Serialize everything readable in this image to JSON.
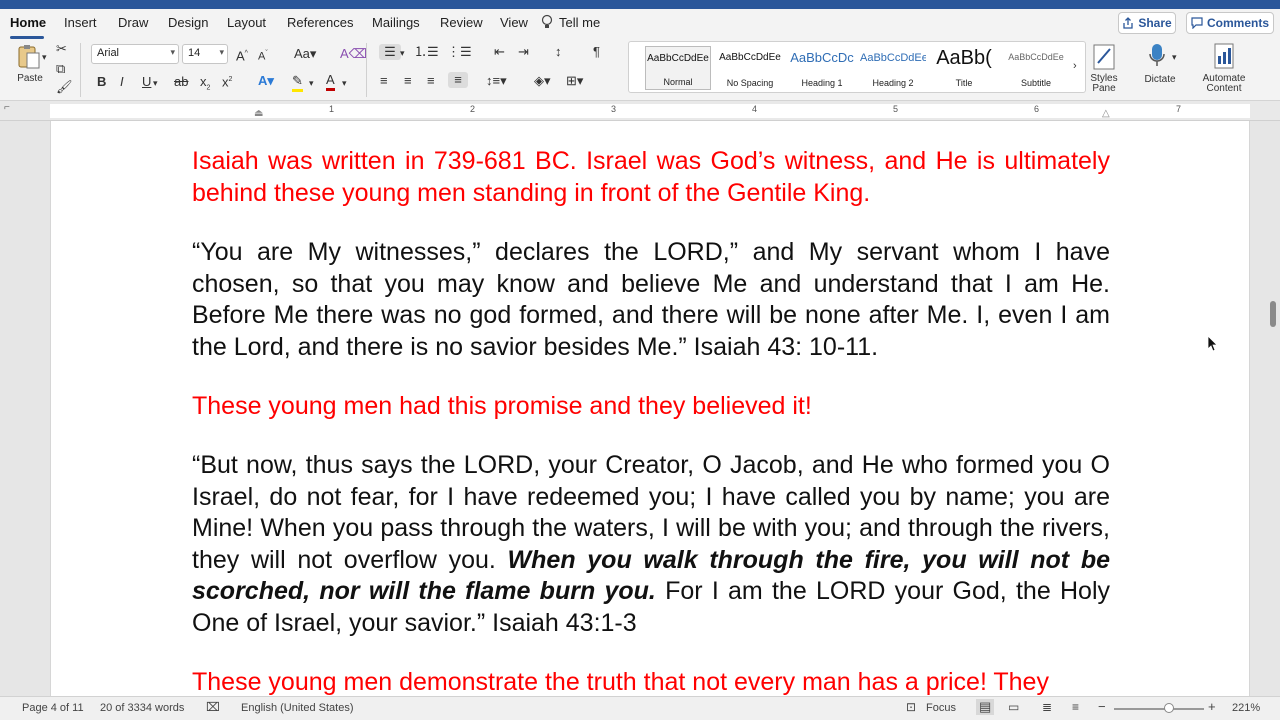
{
  "ribbon_tabs": [
    "Home",
    "Insert",
    "Draw",
    "Design",
    "Layout",
    "References",
    "Mailings",
    "Review",
    "View"
  ],
  "tell_me": "Tell me",
  "share_label": "Share",
  "comments_label": "Comments",
  "clipboard": {
    "paste_label": "Paste"
  },
  "font": {
    "name": "Arial",
    "size": "14"
  },
  "styles": [
    {
      "sample": "AaBbCcDdEe",
      "name": "Normal"
    },
    {
      "sample": "AaBbCcDdEe",
      "name": "No Spacing"
    },
    {
      "sample": "AaBbCcDc",
      "name": "Heading 1"
    },
    {
      "sample": "AaBbCcDdEe",
      "name": "Heading 2"
    },
    {
      "sample": "AaBb(",
      "name": "Title"
    },
    {
      "sample": "AaBbCcDdEe",
      "name": "Subtitle"
    }
  ],
  "tools": {
    "styles_pane": [
      "Styles",
      "Pane"
    ],
    "dictate": "Dictate",
    "automate": [
      "Automate",
      "Content"
    ]
  },
  "ruler_numbers": [
    "1",
    "2",
    "3",
    "4",
    "5",
    "6",
    "7"
  ],
  "document": {
    "p1": "Isaiah was written in 739-681 BC. Israel was God’s witness, and He is ultimately behind these young men standing in front of the Gentile King.",
    "p2": "“You are My witnesses,” declares the LORD,” and My servant whom I have chosen, so that you may know and believe Me and understand that I am He. Before Me there was no god formed, and there will be none after Me. I, even I am the Lord, and there is no savior besides Me.” Isaiah 43: 10-11.",
    "p3": "These young men had this promise and they believed it!",
    "p4_a": "“But now, thus says the LORD, your Creator, O Jacob, and He who formed you O Israel, do not fear, for I have redeemed you; I have called you by name; you are Mine! When you pass through the waters, I will be with you; and through the rivers, they will not overflow you. ",
    "p4_b": "When you walk through the fire, you will not be scorched, nor will the flame burn you.",
    "p4_c": " For I am the LORD your God, the Holy One of Israel, your savior.” Isaiah 43:1-3",
    "p5": "These young men demonstrate the truth that not every man has a price! They"
  },
  "status": {
    "page": "Page 4 of 11",
    "words": "20 of 3334 words",
    "language": "English (United States)",
    "focus": "Focus",
    "zoom": "221%"
  },
  "colors": {
    "accent": "#2b579a",
    "red_text": "#ff0000"
  }
}
